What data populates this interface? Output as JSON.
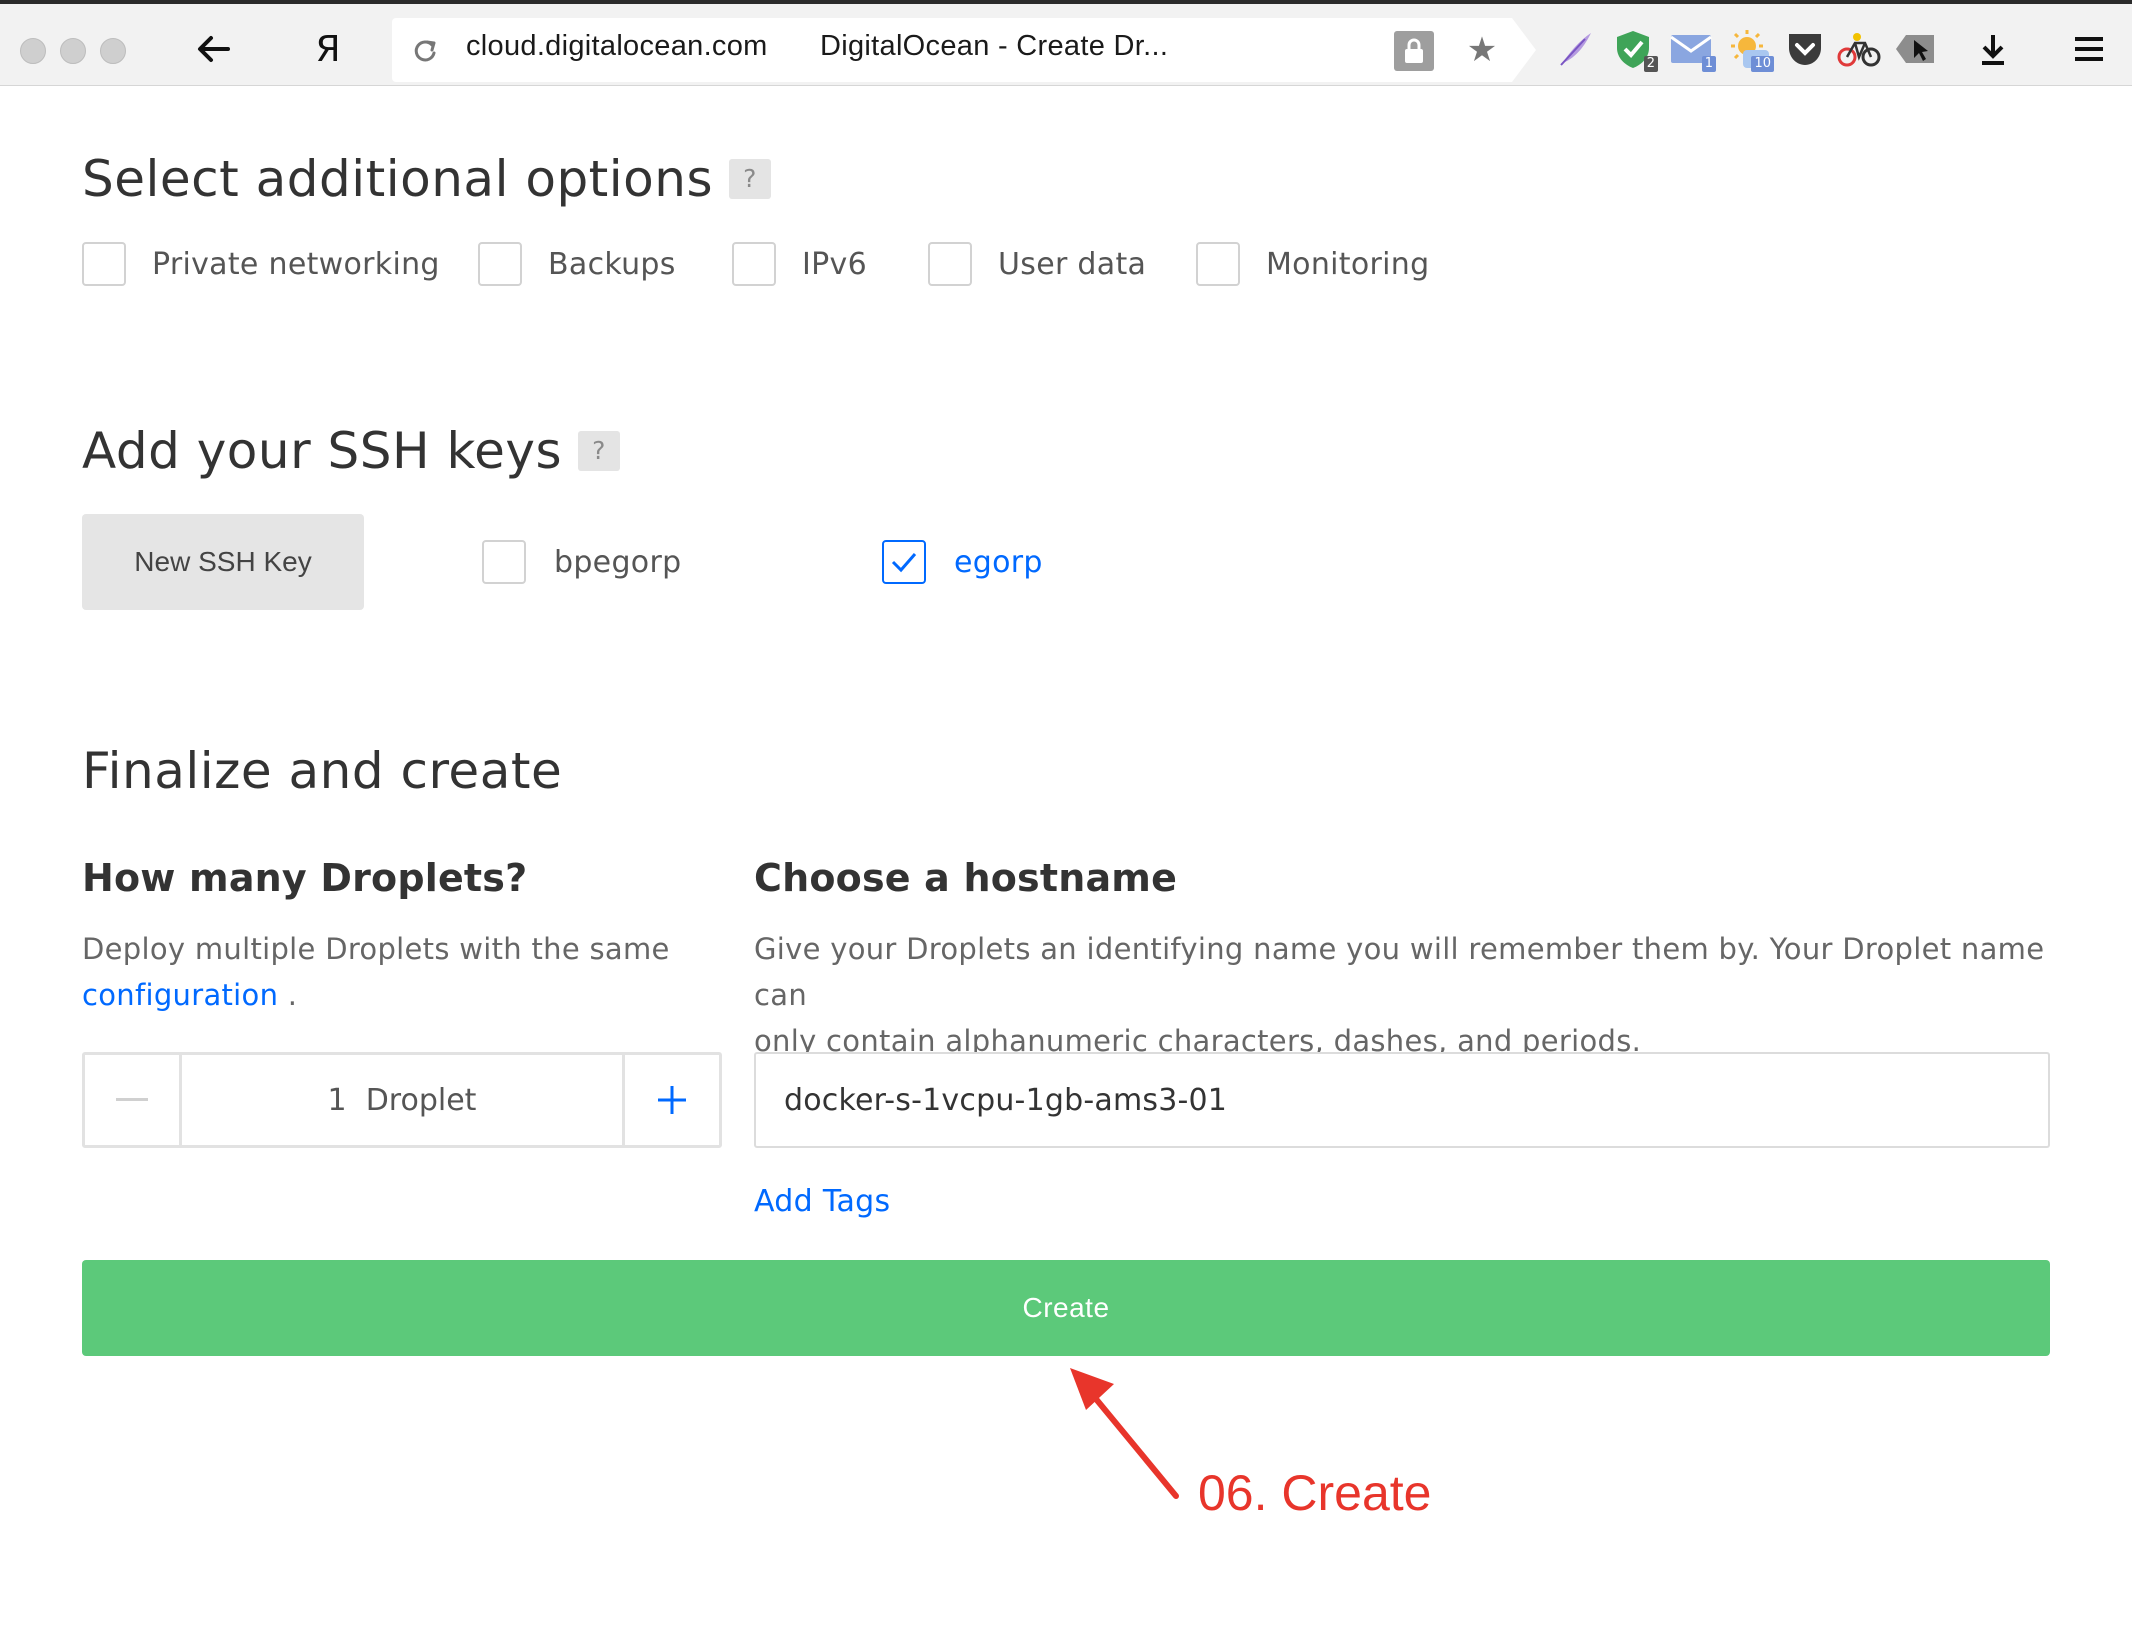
{
  "browser": {
    "address_domain": "cloud.digitalocean.com",
    "tab_title": "DigitalOcean - Create Dr...",
    "yandex_glyph": "Я",
    "extensions": [
      {
        "icon": "feather-icon"
      },
      {
        "icon": "shield-check-icon",
        "badge": "2"
      },
      {
        "icon": "mail-icon",
        "badge": "1"
      },
      {
        "icon": "weather-icon",
        "badge": "10"
      },
      {
        "icon": "pocket-icon"
      },
      {
        "icon": "bike-icon"
      },
      {
        "icon": "cursor-tag-icon"
      }
    ]
  },
  "options": {
    "title": "Select additional options",
    "help": "?",
    "items": [
      {
        "label": "Private networking",
        "checked": false
      },
      {
        "label": "Backups",
        "checked": false
      },
      {
        "label": "IPv6",
        "checked": false
      },
      {
        "label": "User data",
        "checked": false
      },
      {
        "label": "Monitoring",
        "checked": false
      }
    ]
  },
  "ssh": {
    "title": "Add your SSH keys",
    "help": "?",
    "new_key_label": "New SSH Key",
    "keys": [
      {
        "label": "bpegorp",
        "checked": false
      },
      {
        "label": "egorp",
        "checked": true
      }
    ]
  },
  "finalize": {
    "title": "Finalize and create",
    "droplets": {
      "title": "How many Droplets?",
      "desc_line1": "Deploy multiple Droplets with the same",
      "desc_link": "configuration",
      "desc_tail": " .",
      "count_text": "1  Droplet",
      "minus": "−",
      "plus": "+"
    },
    "hostname": {
      "title": "Choose a hostname",
      "desc_line1": "Give your Droplets an identifying name you will remember them by. Your Droplet name can",
      "desc_line2": "only contain alphanumeric characters, dashes, and periods.",
      "value": "docker-s-1vcpu-1gb-ams3-01",
      "add_tags": "Add Tags"
    },
    "create_label": "Create"
  },
  "annotation": {
    "label": "06. Create",
    "color": "#e8352b"
  },
  "colors": {
    "accent_blue": "#0069ff",
    "create_green": "#5cc97a"
  }
}
